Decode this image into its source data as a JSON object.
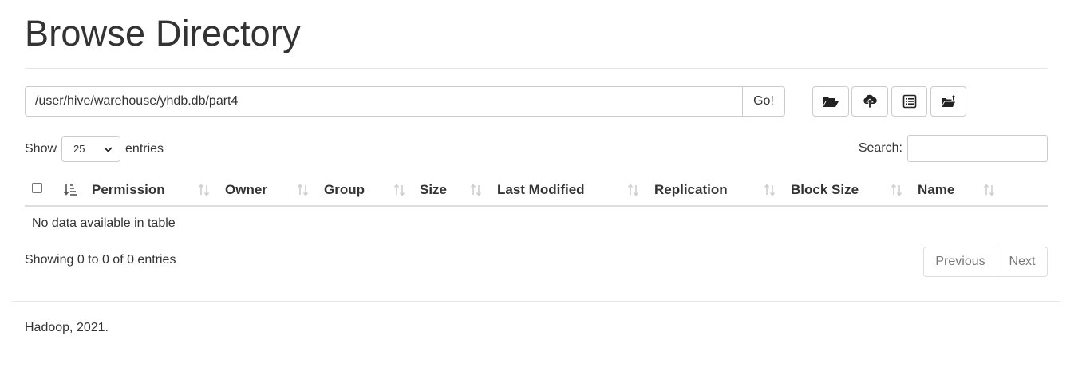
{
  "page": {
    "title": "Browse Directory"
  },
  "path_bar": {
    "value": "/user/hive/warehouse/yhdb.db/part4",
    "go_label": "Go!"
  },
  "toolbar": {
    "icons": [
      "folder-open-icon",
      "cloud-upload-icon",
      "list-alt-icon",
      "folder-upload-icon"
    ]
  },
  "length_control": {
    "prefix": "Show",
    "selected": "25",
    "suffix": "entries"
  },
  "search": {
    "label": "Search:",
    "value": ""
  },
  "table": {
    "columns": [
      "Permission",
      "Owner",
      "Group",
      "Size",
      "Last Modified",
      "Replication",
      "Block Size",
      "Name"
    ],
    "empty_message": "No data available in table"
  },
  "info": {
    "text": "Showing 0 to 0 of 0 entries"
  },
  "pagination": {
    "previous": "Previous",
    "next": "Next"
  },
  "footer": {
    "text": "Hadoop, 2021."
  },
  "colors": {
    "text": "#333333",
    "border": "#cccccc",
    "muted": "#777777"
  }
}
